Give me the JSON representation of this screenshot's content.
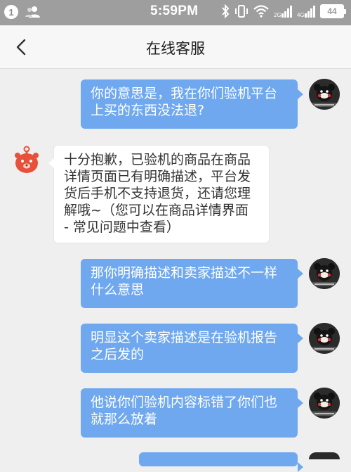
{
  "status_bar": {
    "notification_count": "1",
    "time": "5:59PM",
    "battery": "44",
    "icons": [
      "people-icon",
      "bluetooth-icon",
      "vibrate-icon",
      "wifi-icon",
      "signal-icon",
      "signal-icon-2",
      "battery-icon"
    ]
  },
  "header": {
    "title": "在线客服",
    "back_icon": "chevron-left-icon"
  },
  "messages": [
    {
      "side": "out",
      "lines": [
        "你的意思是，我在你们验机平台",
        "上买的东西没法退?"
      ]
    },
    {
      "side": "in",
      "lines": [
        "十分抱歉，已验机的商品在商品",
        "详情页面已有明确描述，平台发",
        "货后手机不支持退货，还请您理",
        "解哦~（您可以在商品详情界面",
        "- 常见问题中查看）"
      ]
    },
    {
      "side": "out",
      "lines": [
        "那你明确描述和卖家描述不一样",
        "什么意思"
      ]
    },
    {
      "side": "out",
      "lines": [
        "明显这个卖家描述是在验机报告",
        "之后发的"
      ]
    },
    {
      "side": "out",
      "lines": [
        "他说你们验机内容标错了你们也",
        "就那么放着"
      ]
    }
  ],
  "colors": {
    "outgoing_bubble": "#6fa8ee",
    "incoming_bubble": "#ffffff",
    "background": "#efefef",
    "status_bar": "#9e9e9e"
  }
}
